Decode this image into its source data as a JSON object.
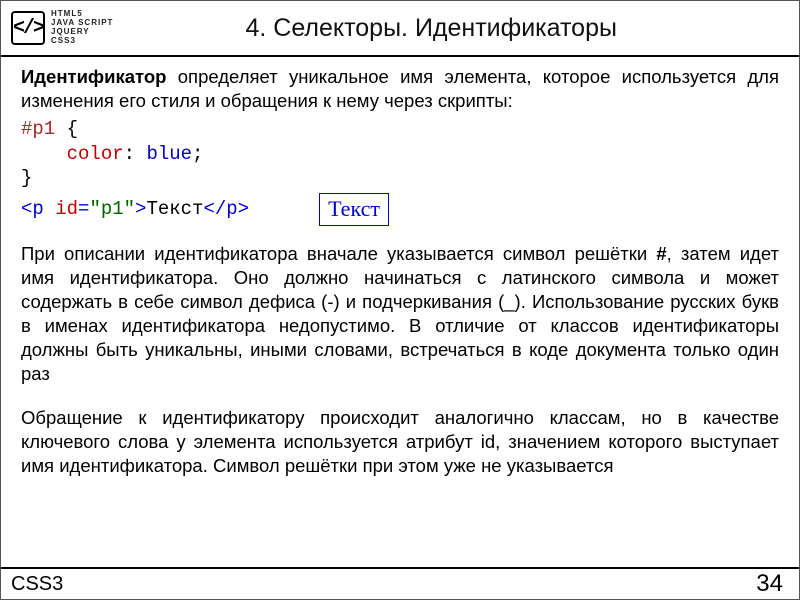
{
  "logo": {
    "glyph": "</>",
    "lines": [
      "HTML5",
      "JAVA SCRIPT",
      "JQUERY",
      "CSS3"
    ]
  },
  "title": "4. Селекторы. Идентификаторы",
  "intro": {
    "lead": "Идентификатор",
    "rest": " определяет уникальное имя элемента, которое используется для изменения его стиля и обращения к нему через скрипты:"
  },
  "code": {
    "selector": "#p1",
    "brace_open": " {",
    "indent": "    ",
    "prop": "color",
    "colon": ": ",
    "value": "blue",
    "semi": ";",
    "brace_close": "}",
    "tag_open1": "<p ",
    "attr": "id",
    "eq": "=",
    "str": "\"p1\"",
    "tag_open2": ">",
    "text": "Текст",
    "tag_close": "</p>"
  },
  "example_text": "Текст",
  "para2_a": "При описании идентификатора вначале указывается символ решётки ",
  "para2_hash": "#",
  "para2_b": ", затем идет имя идентификатора. Оно должно начинаться с латинского символа и может содержать в себе символ дефиса (-) и подчеркивания (_). Использование русских букв в именах идентификатора недопустимо. В отличие от классов идентификаторы должны быть уникальны, иными словами, встречаться в коде документа только один раз",
  "para3": "Обращение к идентификатору происходит аналогично классам, но в качестве ключевого слова у элемента используется атрибут id, значением которого выступает имя идентификатора. Символ решётки при этом уже не указывается",
  "footer": {
    "left": "CSS3",
    "right": "34"
  }
}
